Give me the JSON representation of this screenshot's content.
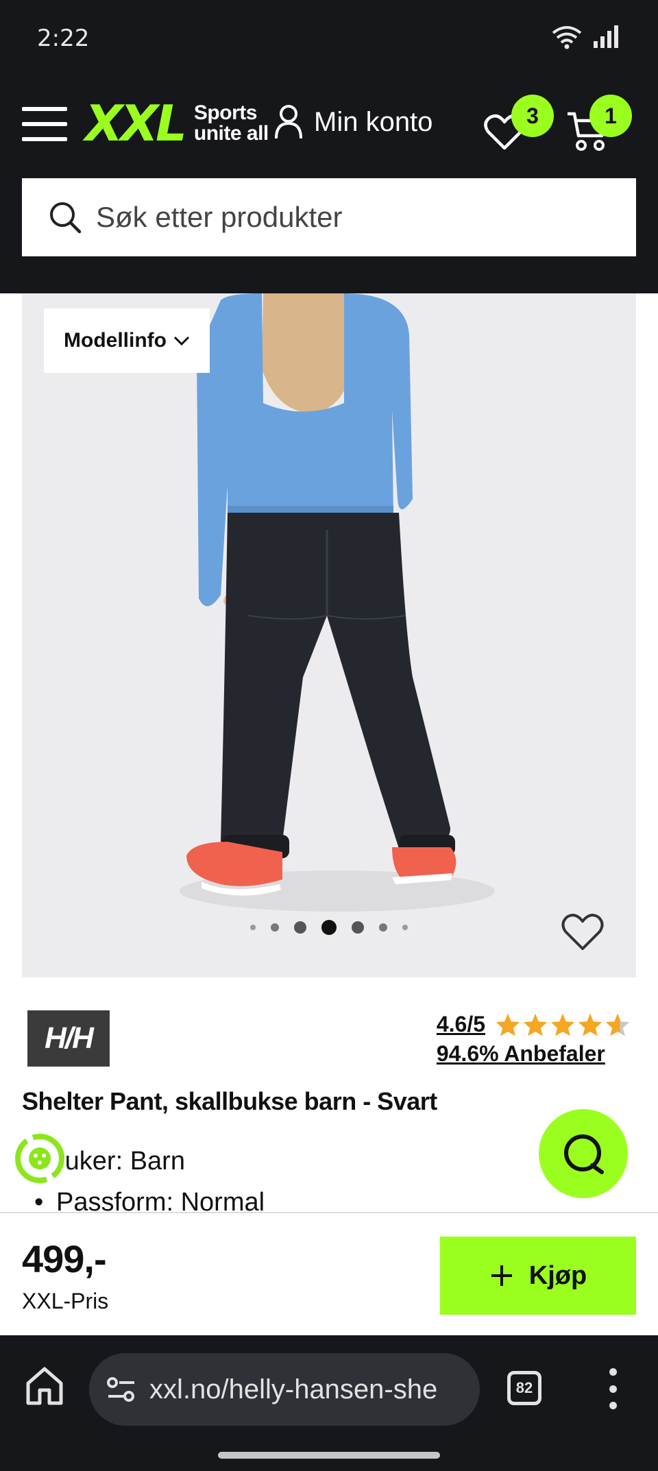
{
  "status": {
    "time": "2:22"
  },
  "header": {
    "logo_text": "XXL",
    "logo_tagline_1": "Sports",
    "logo_tagline_2": "unite all",
    "account_label": "Min konto",
    "wishlist_count": "3",
    "cart_count": "1",
    "accent_color": "#9aff1f",
    "search_placeholder": "Søk etter produkter"
  },
  "gallery": {
    "model_info_label": "Modellinfo",
    "image_count": 7,
    "active_image_index": 3
  },
  "product": {
    "brand_logo_text": "H/H",
    "rating": "4.6/5",
    "stars": 4.6,
    "recommend": "94.6% Anbefaler",
    "title": "Shelter Pant, skallbukse barn - Svart",
    "features": [
      "ruker: Barn",
      "Passform: Normal"
    ],
    "price": "499,-",
    "price_label": "XXL-Pris",
    "buy_label": "Kjøp"
  },
  "browser": {
    "url": "xxl.no/helly-hansen-she",
    "tab_count": "82"
  }
}
